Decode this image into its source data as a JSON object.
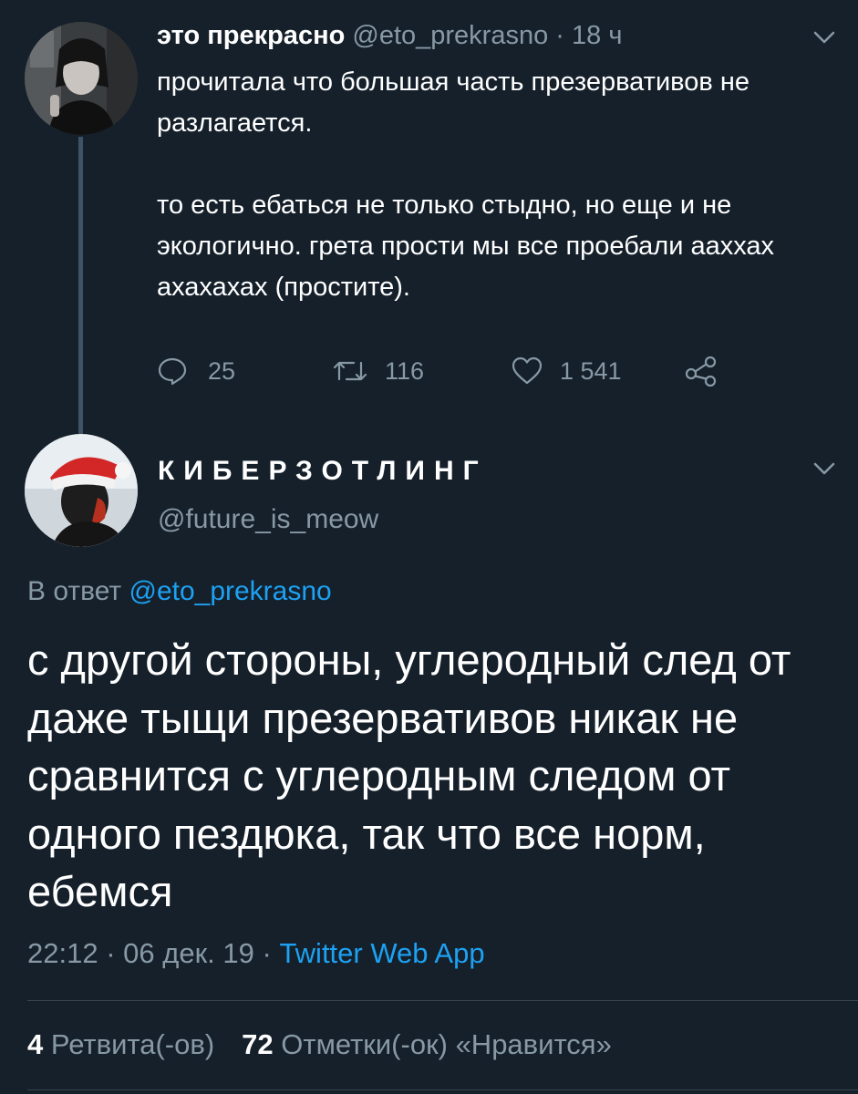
{
  "parent_tweet": {
    "display_name": "это прекрасно",
    "handle": "@eto_prekrasno",
    "separator": "·",
    "time_ago": "18 ч",
    "body": [
      "прочитала что большая часть презервативов не разлагается.",
      "то есть ебаться не только стыдно, но еще и не экологично. грета прости мы все проебали ааххах ахахахах (простите)."
    ],
    "actions": {
      "replies": "25",
      "retweets": "116",
      "likes": "1 541"
    }
  },
  "reply_tweet": {
    "display_name": "КИБЕРЗОТЛИНГ",
    "handle": "@future_is_meow",
    "reply_prefix": "В ответ",
    "reply_to": "@eto_prekrasno",
    "body": "с другой стороны, углеродный след от даже тыщи презервативов никак не сравнится с углеродным следом от одного пездюка, так что все норм, ебемся",
    "time": "22:12",
    "date": "06 дек. 19",
    "separator": "·",
    "source": "Twitter Web App",
    "retweet_count": "4",
    "retweet_label": "Ретвита(-ов)",
    "like_count": "72",
    "like_label": "Отметки(-ок) «Нравится»"
  },
  "colors": {
    "background": "#15202b",
    "secondary_text": "#8899a6",
    "link": "#1da1f2",
    "divider": "#38444d"
  }
}
